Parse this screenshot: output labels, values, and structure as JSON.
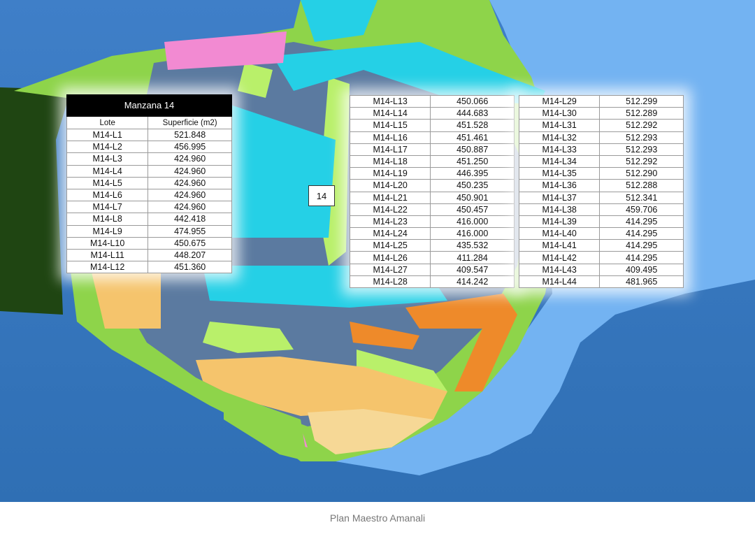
{
  "colors": {
    "ocean": "#3a78c0",
    "lagoon": "#73b3f2",
    "land_green": "#8ed44a",
    "fairway": "#b9f06a",
    "road": "#5b7aa0",
    "lots_cyan": "#25d0e6",
    "lots_orange": "#ee8a2a",
    "lots_sand": "#f5c46c",
    "lots_light": "#f6d896",
    "pink": "#f28ad2",
    "dark_green": "#1f4512"
  },
  "block_label": "14",
  "caption": "Plan Maestro Amanali",
  "tables": [
    {
      "title": "Manzana 14",
      "headers": [
        "Lote",
        "Superficie (m2)"
      ],
      "rows": [
        [
          "M14-L1",
          "521.848"
        ],
        [
          "M14-L2",
          "456.995"
        ],
        [
          "M14-L3",
          "424.960"
        ],
        [
          "M14-L4",
          "424.960"
        ],
        [
          "M14-L5",
          "424.960"
        ],
        [
          "M14-L6",
          "424.960"
        ],
        [
          "M14-L7",
          "424.960"
        ],
        [
          "M14-L8",
          "442.418"
        ],
        [
          "M14-L9",
          "474.955"
        ],
        [
          "M14-L10",
          "450.675"
        ],
        [
          "M14-L11",
          "448.207"
        ],
        [
          "M14-L12",
          "451.360"
        ]
      ]
    },
    {
      "rows": [
        [
          "M14-L13",
          "450.066"
        ],
        [
          "M14-L14",
          "444.683"
        ],
        [
          "M14-L15",
          "451.528"
        ],
        [
          "M14-L16",
          "451.461"
        ],
        [
          "M14-L17",
          "450.887"
        ],
        [
          "M14-L18",
          "451.250"
        ],
        [
          "M14-L19",
          "446.395"
        ],
        [
          "M14-L20",
          "450.235"
        ],
        [
          "M14-L21",
          "450.901"
        ],
        [
          "M14-L22",
          "450.457"
        ],
        [
          "M14-L23",
          "416.000"
        ],
        [
          "M14-L24",
          "416.000"
        ],
        [
          "M14-L25",
          "435.532"
        ],
        [
          "M14-L26",
          "411.284"
        ],
        [
          "M14-L27",
          "409.547"
        ],
        [
          "M14-L28",
          "414.242"
        ]
      ]
    },
    {
      "rows": [
        [
          "M14-L29",
          "512.299"
        ],
        [
          "M14-L30",
          "512.289"
        ],
        [
          "M14-L31",
          "512.292"
        ],
        [
          "M14-L32",
          "512.293"
        ],
        [
          "M14-L33",
          "512.293"
        ],
        [
          "M14-L34",
          "512.292"
        ],
        [
          "M14-L35",
          "512.290"
        ],
        [
          "M14-L36",
          "512.288"
        ],
        [
          "M14-L37",
          "512.341"
        ],
        [
          "M14-L38",
          "459.706"
        ],
        [
          "M14-L39",
          "414.295"
        ],
        [
          "M14-L40",
          "414.295"
        ],
        [
          "M14-L41",
          "414.295"
        ],
        [
          "M14-L42",
          "414.295"
        ],
        [
          "M14-L43",
          "409.495"
        ],
        [
          "M14-L44",
          "481.965"
        ]
      ]
    }
  ]
}
